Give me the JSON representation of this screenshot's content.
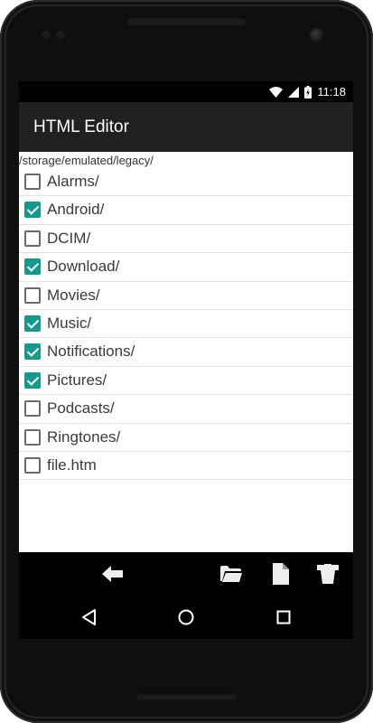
{
  "status_bar": {
    "time": "11:18"
  },
  "app_bar": {
    "title": "HTML Editor"
  },
  "current_path": "/storage/emulated/legacy/",
  "files": [
    {
      "name": "Alarms/",
      "checked": false
    },
    {
      "name": "Android/",
      "checked": true
    },
    {
      "name": "DCIM/",
      "checked": false
    },
    {
      "name": "Download/",
      "checked": true
    },
    {
      "name": "Movies/",
      "checked": false
    },
    {
      "name": "Music/",
      "checked": true
    },
    {
      "name": "Notifications/",
      "checked": true
    },
    {
      "name": "Pictures/",
      "checked": true
    },
    {
      "name": "Podcasts/",
      "checked": false
    },
    {
      "name": "Ringtones/",
      "checked": false
    },
    {
      "name": "file.htm",
      "checked": false
    }
  ],
  "toolbar_icons": [
    "back-arrow-icon",
    "folder-icon",
    "file-icon",
    "delete-icon"
  ],
  "nav_icons": [
    "nav-back-icon",
    "nav-home-icon",
    "nav-recents-icon"
  ],
  "colors": {
    "accent": "#149a8c",
    "app_bar": "#212121",
    "divider": "#e3e3e3"
  }
}
